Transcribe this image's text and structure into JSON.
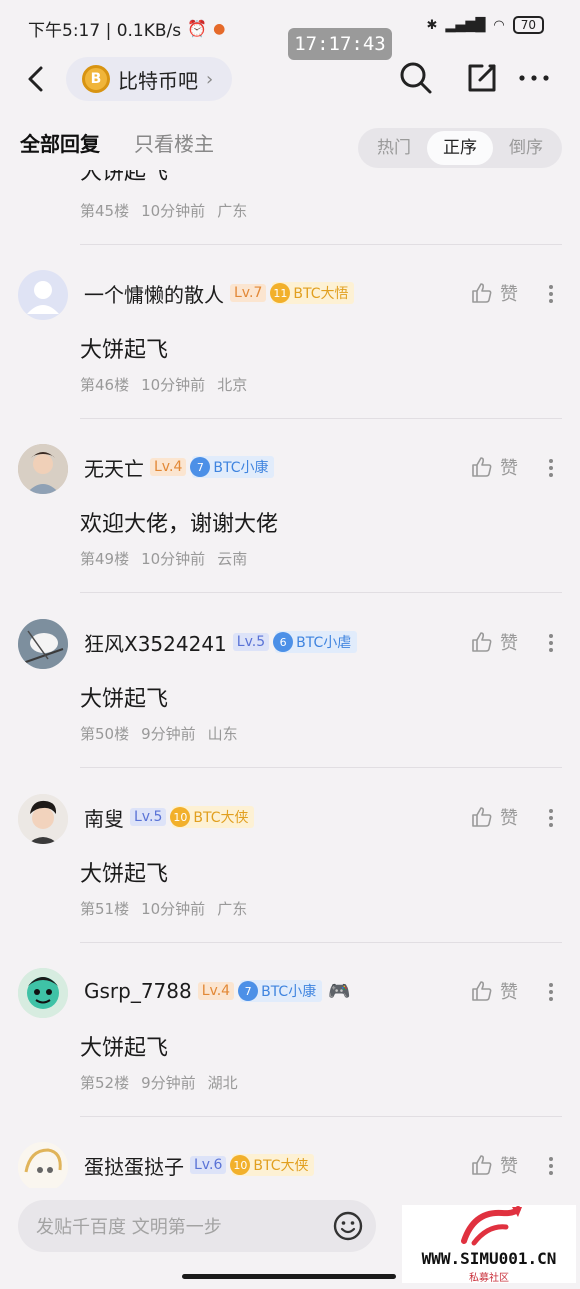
{
  "status": {
    "left_text": "下午5:17 | 0.1KB/s",
    "battery": "70",
    "clock_pill": "17:17:43"
  },
  "header": {
    "forum_name": "比特币吧",
    "forum_icon_letter": "B"
  },
  "tabs": {
    "all": "全部回复",
    "owner": "只看楼主"
  },
  "sort": {
    "hot": "热门",
    "asc": "正序",
    "desc": "倒序",
    "active": "正序"
  },
  "like_label": "赞",
  "posts": [
    {
      "username": "",
      "level": "",
      "badge_num": "",
      "badge_text": "",
      "content": "大饼起飞",
      "floor": "第45楼",
      "time": "10分钟前",
      "location": "广东"
    },
    {
      "username": "一个慵懒的散人",
      "level": "Lv.7",
      "level_color": "orange",
      "badge_num": "11",
      "badge_text": "BTC大悟",
      "badge_color": "gold",
      "content": "大饼起飞",
      "floor": "第46楼",
      "time": "10分钟前",
      "location": "北京"
    },
    {
      "username": "无天亡",
      "level": "Lv.4",
      "level_color": "orange",
      "badge_num": "7",
      "badge_text": "BTC小康",
      "badge_color": "blue",
      "content": "欢迎大佬，谢谢大佬",
      "floor": "第49楼",
      "time": "10分钟前",
      "location": "云南"
    },
    {
      "username": "狂风X3524241",
      "level": "Lv.5",
      "level_color": "blue",
      "badge_num": "6",
      "badge_text": "BTC小虐",
      "badge_color": "blue",
      "content": "大饼起飞",
      "floor": "第50楼",
      "time": "9分钟前",
      "location": "山东"
    },
    {
      "username": "南叟",
      "level": "Lv.5",
      "level_color": "blue",
      "badge_num": "10",
      "badge_text": "BTC大侠",
      "badge_color": "gold",
      "content": "大饼起飞",
      "floor": "第51楼",
      "time": "10分钟前",
      "location": "广东"
    },
    {
      "username": "Gsrp_7788",
      "level": "Lv.4",
      "level_color": "orange",
      "badge_num": "7",
      "badge_text": "BTC小康",
      "badge_color": "blue",
      "content": "大饼起飞",
      "floor": "第52楼",
      "time": "9分钟前",
      "location": "湖北"
    },
    {
      "username": "蛋挞蛋挞子",
      "level": "Lv.6",
      "level_color": "blue",
      "badge_num": "10",
      "badge_text": "BTC大侠",
      "badge_color": "gold",
      "content": "",
      "floor": "",
      "time": "",
      "location": ""
    }
  ],
  "bottom": {
    "input_placeholder": "发贴千百度 文明第一步"
  },
  "watermark": {
    "url": "WWW.SIMU001.CN",
    "sub": "私募社区"
  }
}
